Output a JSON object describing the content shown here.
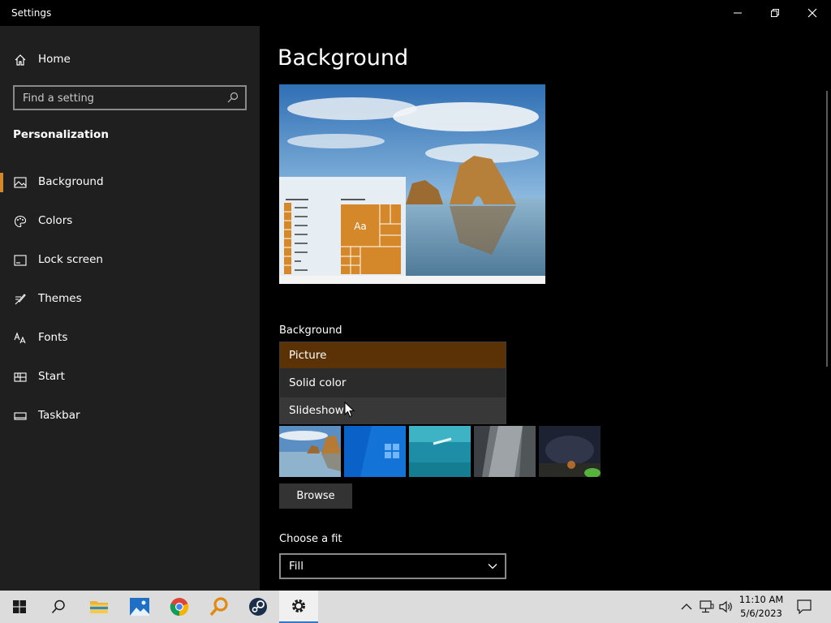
{
  "window": {
    "title": "Settings",
    "controls": [
      "minimize",
      "restore",
      "close"
    ]
  },
  "sidebar": {
    "home_label": "Home",
    "search_placeholder": "Find a setting",
    "section_title": "Personalization",
    "items": [
      {
        "label": "Background",
        "icon": "picture-icon",
        "selected": true
      },
      {
        "label": "Colors",
        "icon": "palette-icon",
        "selected": false
      },
      {
        "label": "Lock screen",
        "icon": "lock-screen-icon",
        "selected": false
      },
      {
        "label": "Themes",
        "icon": "brush-icon",
        "selected": false
      },
      {
        "label": "Fonts",
        "icon": "font-icon",
        "selected": false
      },
      {
        "label": "Start",
        "icon": "start-icon",
        "selected": false
      },
      {
        "label": "Taskbar",
        "icon": "taskbar-icon",
        "selected": false
      }
    ]
  },
  "main": {
    "page_title": "Background",
    "preview": {
      "tile_text": "Aa"
    },
    "background_label": "Background",
    "background_options": [
      {
        "label": "Picture",
        "state": "selected"
      },
      {
        "label": "Solid color",
        "state": "normal"
      },
      {
        "label": "Slideshow",
        "state": "hover"
      }
    ],
    "thumbnails": [
      "beach-rock",
      "windows-blue",
      "underwater-swimmer",
      "rock-cliff",
      "night-sky-tent"
    ],
    "browse_label": "Browse",
    "fit_label": "Choose a fit",
    "fit_value": "Fill"
  },
  "taskbar": {
    "apps": [
      "start-icon",
      "search-icon",
      "file-explorer-icon",
      "photos-icon",
      "chrome-icon",
      "magnifier-app-icon",
      "steam-icon",
      "settings-icon"
    ],
    "active_app": "settings-icon",
    "clock_time": "11:10 AM",
    "clock_date": "5/6/2023",
    "colors": {
      "accent": "#d4882a",
      "selected_option": "#5b3205",
      "taskbar": "#dcdcdc"
    }
  }
}
